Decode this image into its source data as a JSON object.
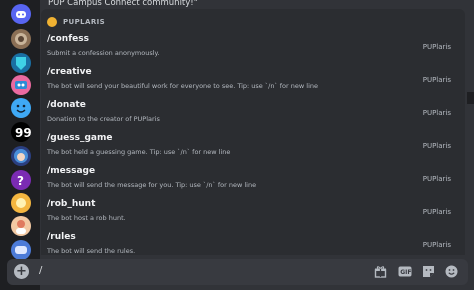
{
  "channel": {
    "preview_text": "PUP Campus Connect community!\""
  },
  "guilds": [
    {
      "name": "guild-discord-icon",
      "color": "#5865f2"
    },
    {
      "name": "guild-server-avatar-1",
      "color": "#8b6f55"
    },
    {
      "name": "guild-server-avatar-2",
      "color": "#3fa9d6"
    },
    {
      "name": "guild-server-avatar-3",
      "color": "#ea6aa0"
    },
    {
      "name": "guild-server-avatar-4",
      "color": "#3fa9f5"
    },
    {
      "name": "guild-server-avatar-5",
      "color": "#000000"
    },
    {
      "name": "guild-server-avatar-6",
      "color": "#4a8fd9"
    },
    {
      "name": "guild-server-avatar-7",
      "color": "#7b2bb3"
    },
    {
      "name": "guild-server-avatar-8",
      "color": "#f4b640"
    },
    {
      "name": "guild-server-avatar-9",
      "color": "#f3c9a3"
    },
    {
      "name": "guild-server-avatar-10",
      "color": "#4c7bd8"
    }
  ],
  "autocomplete": {
    "bot_name": "PUPLARIS",
    "commands": [
      {
        "name": "/confess",
        "description": "Submit a confession anonymously.",
        "bot": "PUPlaris"
      },
      {
        "name": "/creative",
        "description": "The bot will send your beautiful work for everyone to see. Tip: use `/n` for new line",
        "bot": "PUPlaris"
      },
      {
        "name": "/donate",
        "description": "Donation to the creator of PUPlaris",
        "bot": "PUPlaris"
      },
      {
        "name": "/guess_game",
        "description": "The bot held a guessing game. Tip: use `/n` for new line",
        "bot": "PUPlaris"
      },
      {
        "name": "/message",
        "description": "The bot will send the message for you. Tip: use `/n` for new line",
        "bot": "PUPlaris"
      },
      {
        "name": "/rob_hunt",
        "description": "The bot host a rob hunt.",
        "bot": "PUPlaris"
      },
      {
        "name": "/rules",
        "description": "The bot will send the rules.",
        "bot": "PUPlaris"
      }
    ]
  },
  "input": {
    "value": "/"
  },
  "toolbar": [
    "gift-icon",
    "gif-icon",
    "sticker-icon",
    "emoji-icon"
  ]
}
